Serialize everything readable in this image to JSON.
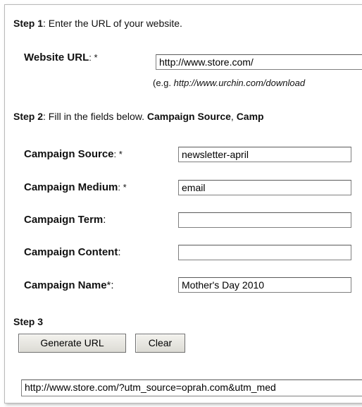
{
  "step1": {
    "label": "Step 1",
    "text": ": Enter the URL of your website.",
    "website_url_label": "Website URL",
    "website_url_suffix": ": *",
    "website_url_value": "http://www.store.com/",
    "example_prefix": "(e.g. ",
    "example_url": "http://www.urchin.com/download"
  },
  "step2": {
    "label": "Step 2",
    "text_prefix": ": Fill in the fields below. ",
    "text_bold": "Campaign Source",
    "text_sep": ", ",
    "text_bold2": "Camp",
    "fields": {
      "source": {
        "label": "Campaign Source",
        "suffix": ": *",
        "value": "newsletter-april"
      },
      "medium": {
        "label": "Campaign Medium",
        "suffix": ": *",
        "value": "email"
      },
      "term": {
        "label": "Campaign Term",
        "suffix": ":",
        "value": ""
      },
      "content": {
        "label": "Campaign Content",
        "suffix": ":",
        "value": ""
      },
      "name": {
        "label": "Campaign Name",
        "suffix": "*:",
        "value": "Mother's Day 2010"
      }
    }
  },
  "step3": {
    "label": "Step 3",
    "generate_button": "Generate URL",
    "clear_button": "Clear",
    "result_url": "http://www.store.com/?utm_source=oprah.com&utm_med"
  }
}
